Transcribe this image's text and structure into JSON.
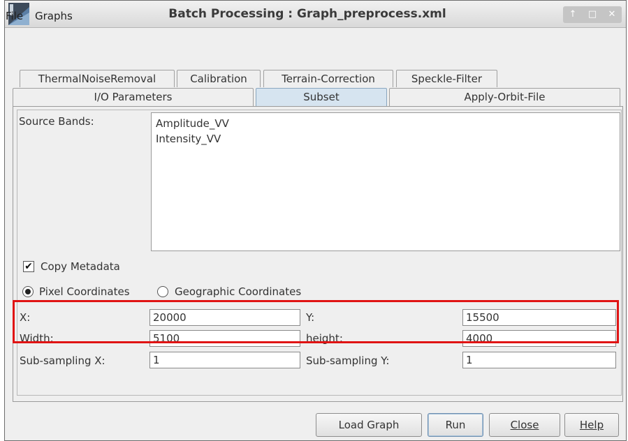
{
  "window": {
    "title": "Batch Processing : Graph_preprocess.xml",
    "controls": [
      "↑",
      "□",
      "✕"
    ]
  },
  "menu": [
    "File",
    "Graphs"
  ],
  "tabs": {
    "back_row": [
      "ThermalNoiseRemoval",
      "Calibration",
      "Terrain-Correction",
      "Speckle-Filter"
    ],
    "front_row": [
      "I/O Parameters",
      "Subset",
      "Apply-Orbit-File"
    ],
    "active": "Subset"
  },
  "subset": {
    "source_bands_label": "Source Bands:",
    "bands": [
      "Amplitude_VV",
      "Intensity_VV"
    ],
    "copy_metadata_label": "Copy Metadata",
    "copy_metadata_checked": true,
    "pixel_coords_label": "Pixel Coordinates",
    "geo_coords_label": "Geographic Coordinates",
    "selected_coords": "pixel",
    "x_label": "X:",
    "x_value": "20000",
    "y_label": "Y:",
    "y_value": "15500",
    "width_label": "Width:",
    "width_value": "5100",
    "height_label": "height:",
    "height_value": "4000",
    "subx_label": "Sub-sampling X:",
    "subx_value": "1",
    "suby_label": "Sub-sampling Y:",
    "suby_value": "1"
  },
  "buttons": {
    "load_graph": "Load Graph",
    "run": "Run",
    "close": "Close",
    "help": "Help"
  },
  "colors": {
    "active_tab": "#d6e4f0",
    "highlight": "#e01414"
  }
}
